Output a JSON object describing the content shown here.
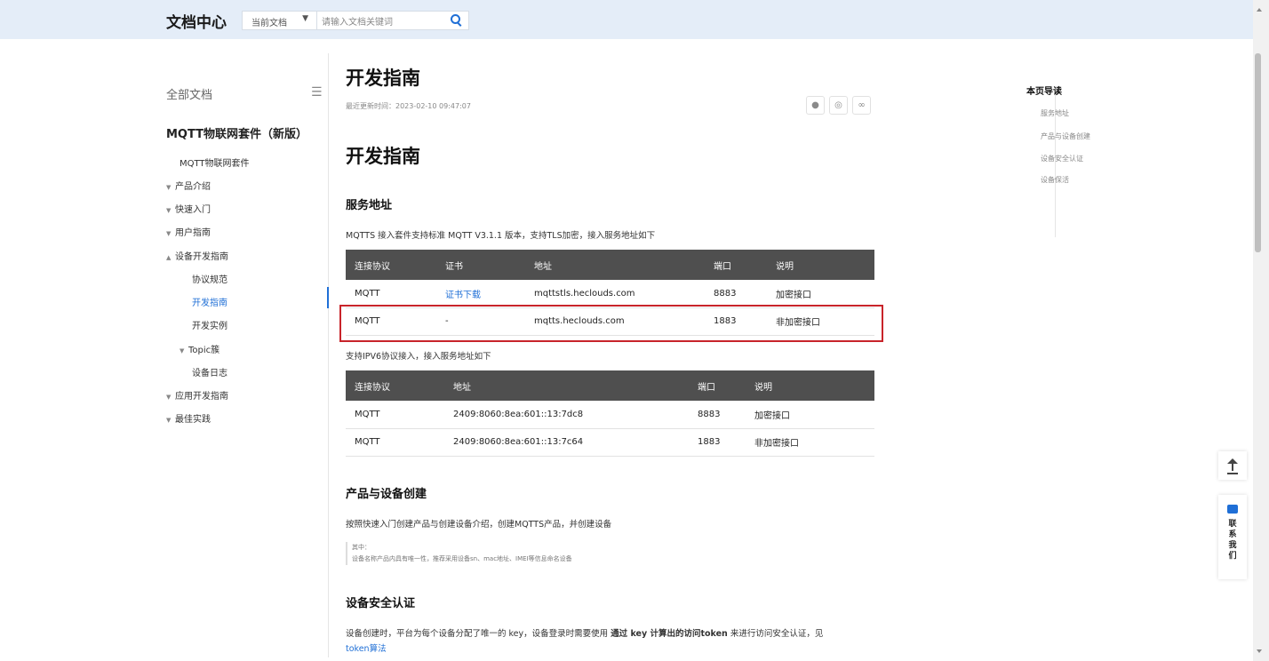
{
  "header": {
    "logo": "文档中心",
    "scope_select": "当前文档",
    "search_placeholder": "请输入文档关键词"
  },
  "sidebar": {
    "all_docs": "全部文档",
    "product_title": "MQTT物联网套件（新版）",
    "items": [
      {
        "label": "MQTT物联网套件",
        "level": 1
      },
      {
        "label": "产品介绍",
        "level": 0,
        "expand": "collapsed"
      },
      {
        "label": "快速入门",
        "level": 0,
        "expand": "collapsed"
      },
      {
        "label": "用户指南",
        "level": 0,
        "expand": "collapsed"
      },
      {
        "label": "设备开发指南",
        "level": 0,
        "expand": "expanded"
      },
      {
        "label": "协议规范",
        "level": 2
      },
      {
        "label": "开发指南",
        "level": 2,
        "active": true
      },
      {
        "label": "开发实例",
        "level": 2
      },
      {
        "label": "Topic簇",
        "level": 1,
        "expand": "collapsed"
      },
      {
        "label": "设备日志",
        "level": 2
      },
      {
        "label": "应用开发指南",
        "level": 0,
        "expand": "collapsed"
      },
      {
        "label": "最佳实践",
        "level": 0,
        "expand": "collapsed"
      }
    ]
  },
  "main": {
    "page_title": "开发指南",
    "updated": "最近更新时间：2023-02-10 09:47:07",
    "article_title": "开发指南",
    "section1_title": "服务地址",
    "section1_desc": "MQTTS 接入套件支持标准 MQTT V3.1.1 版本，支持TLS加密，接入服务地址如下",
    "table1": {
      "headers": [
        "连接协议",
        "证书",
        "地址",
        "端口",
        "说明"
      ],
      "rows": [
        [
          "MQTT",
          "证书下载",
          "mqttstls.heclouds.com",
          "8883",
          "加密接口"
        ],
        [
          "MQTT",
          "-",
          "mqtts.heclouds.com",
          "1883",
          "非加密接口"
        ]
      ]
    },
    "ipv6_desc": "支持IPV6协议接入，接入服务地址如下",
    "table2": {
      "headers": [
        "连接协议",
        "地址",
        "端口",
        "说明"
      ],
      "rows": [
        [
          "MQTT",
          "2409:8060:8ea:601::13:7dc8",
          "8883",
          "加密接口"
        ],
        [
          "MQTT",
          "2409:8060:8ea:601::13:7c64",
          "1883",
          "非加密接口"
        ]
      ]
    },
    "section2_title": "产品与设备创建",
    "section2_desc": "按照快速入门创建产品与创建设备介绍，创建MQTTS产品，并创建设备",
    "note_line1": "其中：",
    "note_line2": "设备名称产品内具有唯一性，推荐采用设备sn、mac地址、IMEI等信息命名设备",
    "section3_title": "设备安全认证",
    "section3_desc_a": "设备创建时，平台为每个设备分配了唯一的 key，设备登录时需要使用 ",
    "section3_desc_b": "通过 key 计算出的访问token",
    "section3_desc_c": " 来进行访问安全认证，见",
    "section3_link": "token算法"
  },
  "toc": {
    "title": "本页导读",
    "items": [
      "服务地址",
      "产品与设备创建",
      "设备安全认证",
      "设备保活"
    ]
  },
  "floating": {
    "contact_label": "联系我们"
  },
  "colors": {
    "accent": "#1f6fd6",
    "topbar": "#e4edf8",
    "table_header": "#4f4f4f",
    "highlight_box": "#c8242a"
  }
}
